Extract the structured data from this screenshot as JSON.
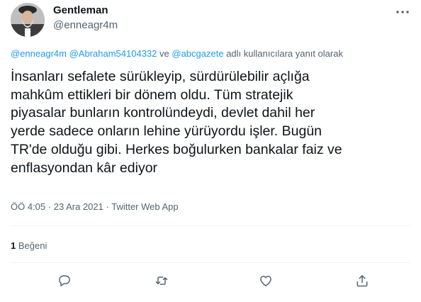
{
  "author": {
    "name": "Gentleman",
    "handle": "@enneagr4m",
    "avatar_icon": "bearded-man-avatar"
  },
  "reply_context": {
    "mention_1": "@enneagr4m",
    "mention_2": "@Abraham54104332",
    "connector": "ve",
    "mention_3": "@abcgazete",
    "suffix": "adlı kullanıcılara yanıt olarak"
  },
  "tweet": {
    "lines": [
      "İnsanları sefalete sürükleyip, sürdürülebilir açlığa",
      "mahkûm ettikleri bir dönem oldu. Tüm stratejik",
      "piyasalar bunların kontrolündeydi, devlet dahil her",
      "yerde sadece onların lehine yürüyordu işler. Bugün",
      "TR'de olduğu gibi. Herkes boğulurken bankalar faiz ve",
      "enflasyondan kâr ediyor"
    ]
  },
  "meta": {
    "time": "ÖÖ 4:05",
    "separator": "·",
    "date": "23 Ara 2021",
    "source": "Twitter Web App"
  },
  "stats": {
    "like_count": "1",
    "like_label": "Beğeni"
  },
  "colors": {
    "accent": "#1d9bf0",
    "text": "#0f1419",
    "secondary": "#536471",
    "divider": "#eff3f4"
  },
  "actions": [
    "reply-icon",
    "retweet-icon",
    "like-icon",
    "share-icon"
  ]
}
